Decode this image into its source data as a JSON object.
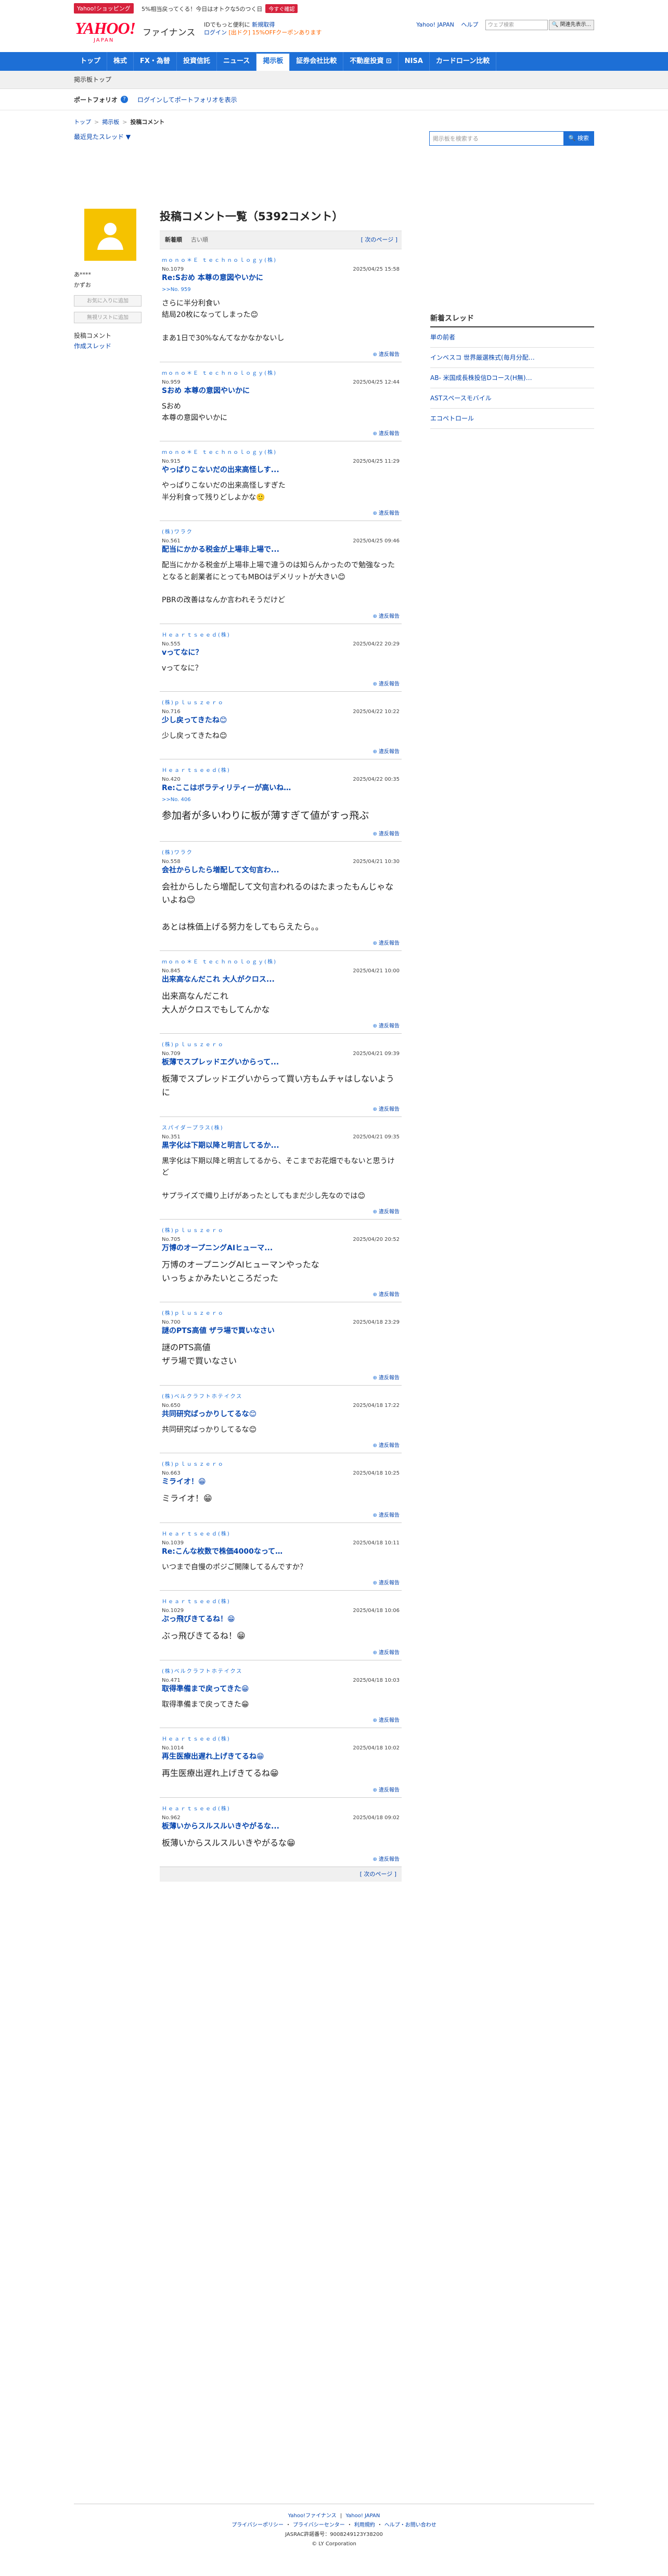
{
  "promo": {
    "badge": "Yahoo!ショッピング",
    "text": "5%相当戻ってくる！今日はオトクな5のつく日",
    "button": "今すぐ確認"
  },
  "header": {
    "logo": "YAHOO!",
    "logo_sub": "JAPAN",
    "service": "ファイナンス",
    "msg1_prefix": "IDでもっと便利に",
    "msg1_link": "新規取得",
    "msg2_link": "ログイン",
    "msg2_coupon": "[出ドク] 15%OFFクーポンあります",
    "links": [
      "Yahoo! JAPAN",
      "ヘルプ"
    ],
    "search_placeholder": "ウェブ検索",
    "search_button": "🔍 関連先表示..."
  },
  "nav": {
    "items": [
      "トップ",
      "株式",
      "FX・為替",
      "投資信託",
      "ニュース",
      "掲示板",
      "証券会社比較",
      "不動産投資 ⊡",
      "NISA",
      "カードローン比較"
    ],
    "active": "掲示板"
  },
  "sub_nav": {
    "label": "掲示板トップ"
  },
  "portfolio": {
    "label": "ポートフォリオ",
    "help": "?",
    "link": "ログインしてポートフォリオを表示"
  },
  "breadcrumb": [
    "トップ",
    "掲示板",
    "投稿コメント"
  ],
  "recent_threads": "最近見たスレッド ▼",
  "board_search": {
    "placeholder": "掲示板を検索する",
    "button": "🔍 検索"
  },
  "profile": {
    "name": "あ****",
    "name2": "かずお",
    "add_fav": "お気に入りに追加",
    "add_block": "無視リストに追加",
    "menu": [
      "投稿コメント",
      "作成スレッド"
    ]
  },
  "main": {
    "title": "投稿コメント一覧（5392コメント）",
    "tab_new": "新着順",
    "tab_old": "古い順",
    "next": "[ 次のページ ]",
    "report": "違反報告"
  },
  "posts": [
    {
      "author": "ｍｏｎｏ＊Ｅ ｔｅｃｈｎｏｌｏｇｙ(株)",
      "no": "No.1079",
      "date": "2025/04/25 15:58",
      "title": "Re:Sおめ 本尊の意図やいかに",
      "reply": ">>No. 959",
      "body": "さらに半分利食い\n結局20枚になってしまった😊\n\nまあ1日で30%なんてなかなかないし",
      "size": "s13"
    },
    {
      "author": "ｍｏｎｏ＊Ｅ ｔｅｃｈｎｏｌｏｇｙ(株)",
      "no": "No.959",
      "date": "2025/04/25 12:44",
      "title": "Sおめ 本尊の意図やいかに",
      "reply": "",
      "body": "Sおめ\n本尊の意図やいかに",
      "size": "s13"
    },
    {
      "author": "ｍｏｎｏ＊Ｅ ｔｅｃｈｎｏｌｏｇｙ(株)",
      "no": "No.915",
      "date": "2025/04/25 11:29",
      "title": "やっぱりこないだの出来高怪しす...",
      "reply": "",
      "body": "やっぱりこないだの出来高怪しすぎた\n半分利食って残りどしよかな🙂",
      "size": "s13"
    },
    {
      "author": "(株)ワラク",
      "no": "No.561",
      "date": "2025/04/25 09:46",
      "title": "配当にかかる税金が上場非上場で...",
      "reply": "",
      "body": "配当にかかる税金が上場非上場で違うのは知らんかったので勉強なった\nとなると創業者にとってもMBOはデメリットが大きい😊\n\nPBRの改善はなんか言われそうだけど",
      "size": "s13"
    },
    {
      "author": "Ｈｅａｒｔｓｅｅｄ(株)",
      "no": "No.555",
      "date": "2025/04/22 20:29",
      "title": "vってなに？",
      "reply": "",
      "body": "vってなに？",
      "size": "s13"
    },
    {
      "author": "(株)ｐｌｕｓｚｅｒｏ",
      "no": "No.716",
      "date": "2025/04/22 10:22",
      "title": "少し戻ってきたね😊",
      "reply": "",
      "body": "少し戻ってきたね😊",
      "size": "s13"
    },
    {
      "author": "Ｈｅａｒｔｓｅｅｄ(株)",
      "no": "No.420",
      "date": "2025/04/22 00:35",
      "title": "Re:ここはボラティリティーが高いね&hellip;",
      "reply": ">>No. 406",
      "body": "参加者が多いわりに板が薄すぎて値がすっ飛ぶ",
      "size": "s18"
    },
    {
      "author": "(株)ワラク",
      "no": "No.558",
      "date": "2025/04/21 10:30",
      "title": "会社からしたら増配して文句言わ...",
      "reply": "",
      "body": "会社からしたら増配して文句言われるのはたまったもんじゃないよね😊\n\nあとは株価上げる努力をしてもらえたら。。",
      "size": "s15"
    },
    {
      "author": "ｍｏｎｏ＊Ｅ ｔｅｃｈｎｏｌｏｇｙ(株)",
      "no": "No.845",
      "date": "2025/04/21 10:00",
      "title": "出来高なんだこれ 大人がクロス...",
      "reply": "",
      "body": "出来高なんだこれ\n大人がクロスでもしてんかな",
      "size": "s15"
    },
    {
      "author": "(株)ｐｌｕｓｚｅｒｏ",
      "no": "No.709",
      "date": "2025/04/21 09:39",
      "title": "板薄でスプレッドエグいからって...",
      "reply": "",
      "body": "板薄でスプレッドエグいからって買い方もムチャはしないように",
      "size": "s15"
    },
    {
      "author": "スパイダープラス(株)",
      "no": "No.351",
      "date": "2025/04/21 09:35",
      "title": "黒字化は下期以降と明言してるか...",
      "reply": "",
      "body": "黒字化は下期以降と明言してるから、そこまでお花畑でもないと思うけど\n\nサプライズで織り上げがあったとしてもまだ少し先なのでは😊",
      "size": "s13"
    },
    {
      "author": "(株)ｐｌｕｓｚｅｒｏ",
      "no": "No.705",
      "date": "2025/04/20 20:52",
      "title": "万博のオープニングAIヒューマ...",
      "reply": "",
      "body": "万博のオープニングAIヒューマンやったな\nいっちょかみたいところだった",
      "size": "s15"
    },
    {
      "author": "(株)ｐｌｕｓｚｅｒｏ",
      "no": "No.700",
      "date": "2025/04/18 23:29",
      "title": "謎のPTS高値 ザラ場で買いなさい",
      "reply": "",
      "body": "謎のPTS高値\nザラ場で買いなさい",
      "size": "s15"
    },
    {
      "author": "(株)ベルクラフトホテイクス",
      "no": "No.650",
      "date": "2025/04/18 17:22",
      "title": "共同研究ばっかりしてるな😊",
      "reply": "",
      "body": "共同研究ばっかりしてるな😊",
      "size": "s13"
    },
    {
      "author": "(株)ｐｌｕｓｚｅｒｏ",
      "no": "No.663",
      "date": "2025/04/18 10:25",
      "title": "ミライオ！😁",
      "reply": "",
      "body": "ミライオ！😁",
      "size": "s15"
    },
    {
      "author": "Ｈｅａｒｔｓｅｅｄ(株)",
      "no": "No.1039",
      "date": "2025/04/18 10:11",
      "title": "Re:こんな枚数で株価4000なって&hellip;",
      "reply": "",
      "body": "いつまで自慢のポジご開陳してるんですか？",
      "size": "s13"
    },
    {
      "author": "Ｈｅａｒｔｓｅｅｄ(株)",
      "no": "No.1029",
      "date": "2025/04/18 10:06",
      "title": "ぶっ飛びきてるね！😁",
      "reply": "",
      "body": "ぶっ飛びきてるね！😁",
      "size": "s15"
    },
    {
      "author": "(株)ベルクラフトホテイクス",
      "no": "No.471",
      "date": "2025/04/18 10:03",
      "title": "取得準備まで戻ってきた😁",
      "reply": "",
      "body": "取得準備まで戻ってきた😁",
      "size": "s13"
    },
    {
      "author": "Ｈｅａｒｔｓｅｅｄ(株)",
      "no": "No.1014",
      "date": "2025/04/18 10:02",
      "title": "再生医療出遅れ上げきてるね😁",
      "reply": "",
      "body": "再生医療出遅れ上げきてるね😁",
      "size": "s15"
    },
    {
      "author": "Ｈｅａｒｔｓｅｅｄ(株)",
      "no": "No.962",
      "date": "2025/04/18 09:02",
      "title": "板薄いからスルスルいきやがるな...",
      "reply": "",
      "body": "板薄いからスルスルいきやがるな😁",
      "size": "s15"
    }
  ],
  "right": {
    "heading": "新着スレッド",
    "items": [
      "単の前者",
      "インベスコ 世界厳選株式(毎月分配…",
      "AB- 米国成長株投信Dコース(H無)…",
      "ASTスペースモバイル",
      "エコペトロール"
    ]
  },
  "footer": {
    "links1": [
      "Yahoo!ファイナンス",
      "Yahoo! JAPAN"
    ],
    "links2": [
      "プライバシーポリシー",
      "プライバシーセンター",
      "利用規約",
      "ヘルプ・お問い合わせ"
    ],
    "notice1": "JASRAC許諾番号：9008249123Y38200",
    "notice2": "© LY Corporation"
  },
  "colors": {
    "brand": "#ff0033",
    "nav": "#1d6fd6",
    "avatar": "#f5c200"
  }
}
